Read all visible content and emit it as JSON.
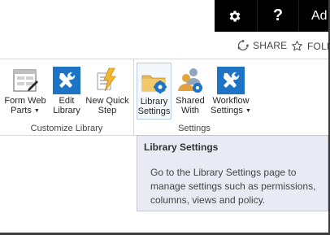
{
  "suite_bar": {
    "gear_icon": "gear-icon",
    "help_label": "?",
    "user_label": "Ad"
  },
  "actions": {
    "share_label": "SHARE",
    "follow_label": "FOLLO"
  },
  "ribbon": {
    "groups": [
      {
        "label": "Customize Library",
        "buttons": [
          {
            "line1": "Form Web",
            "line2": "Parts",
            "dropdown": true,
            "icon": "form-web-parts-icon"
          },
          {
            "line1": "Edit",
            "line2": "Library",
            "dropdown": false,
            "icon": "edit-library-icon"
          },
          {
            "line1": "New Quick",
            "line2": "Step",
            "dropdown": false,
            "icon": "new-quick-step-icon"
          }
        ]
      },
      {
        "label": "Settings",
        "buttons": [
          {
            "line1": "Library",
            "line2": "Settings",
            "dropdown": false,
            "icon": "library-settings-icon",
            "selected": true
          },
          {
            "line1": "Shared",
            "line2": "With",
            "dropdown": false,
            "icon": "shared-with-icon"
          },
          {
            "line1": "Workflow",
            "line2": "Settings",
            "dropdown": true,
            "icon": "workflow-settings-icon"
          }
        ]
      }
    ]
  },
  "tooltip": {
    "title": "Library Settings",
    "body": "Go to the Library Settings page to manage settings such as permissions, columns, views and policy."
  },
  "colors": {
    "suite_bar": "#000000",
    "accent_blue": "#1e74c4",
    "tooltip_bg": "#e9eaf4"
  }
}
